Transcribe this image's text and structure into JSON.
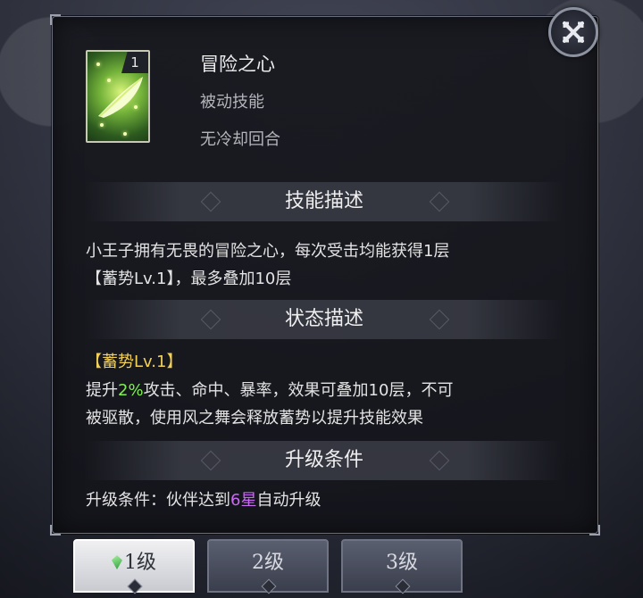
{
  "skill": {
    "name": "冒险之心",
    "level": "1",
    "type": "被动技能",
    "cooldown": "无冷却回合"
  },
  "sections": {
    "description_title": "技能描述",
    "description_text_1": "小王子拥有无畏的冒险之心，每次受击均能获得1层",
    "description_text_2": "【蓄势Lv.1】，最多叠加10层",
    "status_title": "状态描述",
    "status_name": "【蓄势Lv.1】",
    "status_line1_pre": "提升",
    "status_line1_highlight": "2%",
    "status_line1_post": "攻击、命中、暴率，效果可叠加10层，不可",
    "status_line2": "被驱散，使用风之舞会释放蓄势以提升技能效果",
    "upgrade_title": "升级条件",
    "upgrade_pre": "升级条件：伙伴达到",
    "upgrade_highlight": "6星",
    "upgrade_post": "自动升级"
  },
  "tabs": [
    {
      "label": "1级",
      "active": true
    },
    {
      "label": "2级",
      "active": false
    },
    {
      "label": "3级",
      "active": false
    }
  ],
  "colors": {
    "highlight_green": "#7ef04e",
    "highlight_purple": "#c86af2",
    "status_gold": "#f2cf58"
  },
  "icons": {
    "close": "close-x-icon",
    "skill": "glowing-feather-icon",
    "tab_gem": "green-gem-icon"
  }
}
